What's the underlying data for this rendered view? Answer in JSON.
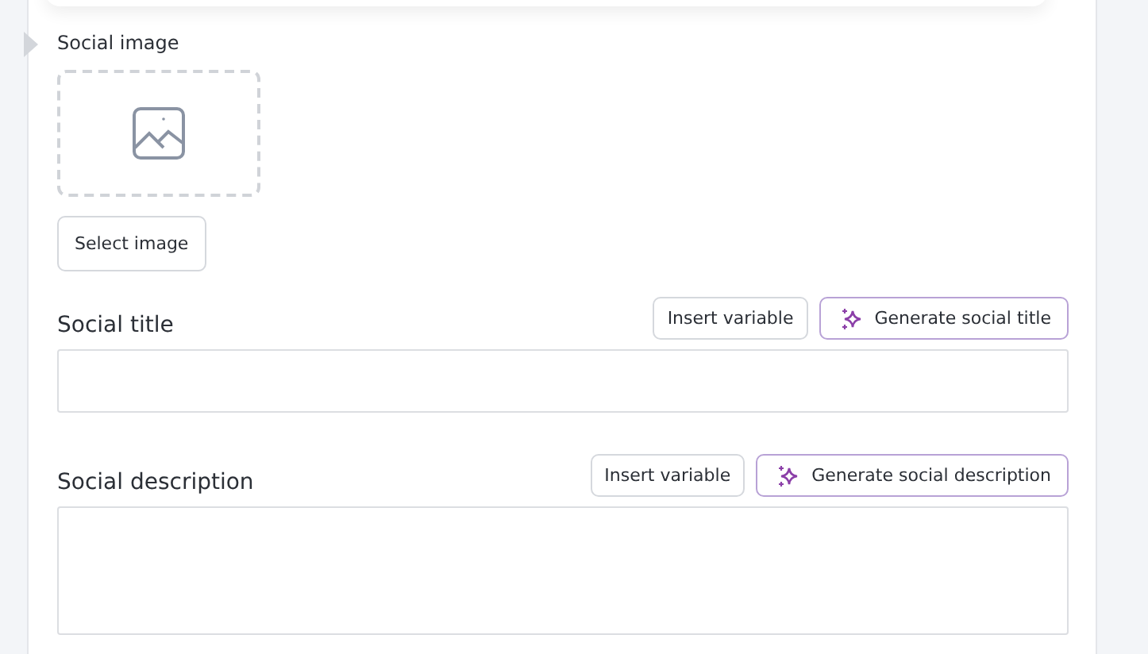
{
  "social_image": {
    "label": "Social image",
    "button": "Select image"
  },
  "fields": [
    {
      "label": "Social title",
      "kind": "line",
      "buttons": [
        {
          "kind": "plain",
          "label": "Insert variable"
        },
        {
          "kind": "ai",
          "label": "Generate social title"
        }
      ]
    },
    {
      "label": "Social description",
      "kind": "area",
      "buttons": [
        {
          "kind": "plain",
          "label": "Insert variable"
        },
        {
          "kind": "ai",
          "label": "Generate social description"
        }
      ]
    }
  ]
}
